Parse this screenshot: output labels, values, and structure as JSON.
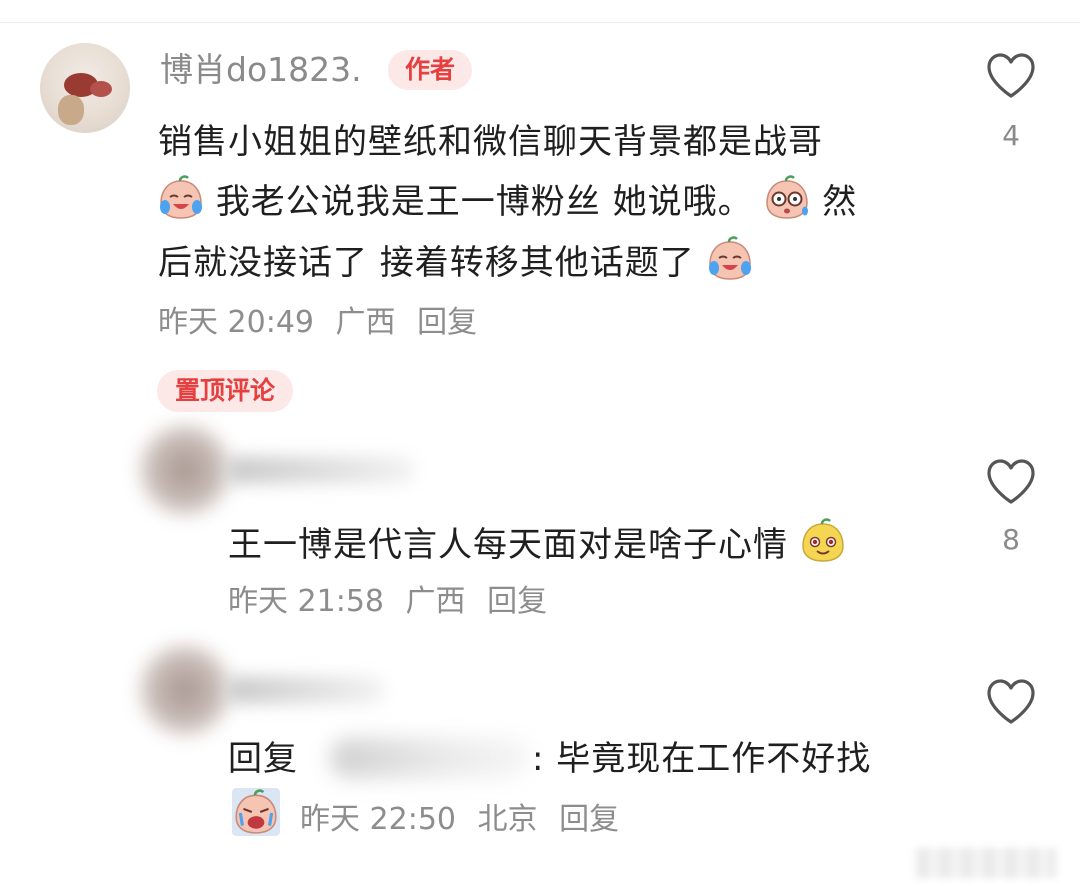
{
  "comments": [
    {
      "username": "博肖do1823.",
      "badge": "作者",
      "text_line1": "销售小姐姐的壁纸和微信聊天背景都是战哥",
      "text_line2_a": "我老公说我是王一博粉丝 她说哦。",
      "text_line2_b": "然",
      "text_line3": "后就没接话了 接着转移其他话题了",
      "time": "昨天 20:49",
      "location": "广西",
      "reply_label": "回复",
      "likes": "4"
    },
    {
      "pinned_label": "置顶评论",
      "text": "王一博是代言人每天面对是啥子心情",
      "time": "昨天 21:58",
      "location": "广西",
      "reply_label": "回复",
      "likes": "8"
    },
    {
      "reply_prefix": "回复",
      "text_suffix": ": 毕竟现在工作不好找",
      "time": "昨天 22:50",
      "location": "北京",
      "reply_label": "回复"
    }
  ],
  "icons": {
    "like": "heart-outline-icon",
    "emoji_cry": "crying-laugh-emoji",
    "emoji_shock": "shocked-glasses-emoji",
    "emoji_yellow": "yellow-smirk-emoji",
    "emoji_wail": "wailing-emoji"
  },
  "colors": {
    "badge_bg": "#fde8e8",
    "badge_text": "#e5403f",
    "meta_text": "#8d8d8d"
  }
}
